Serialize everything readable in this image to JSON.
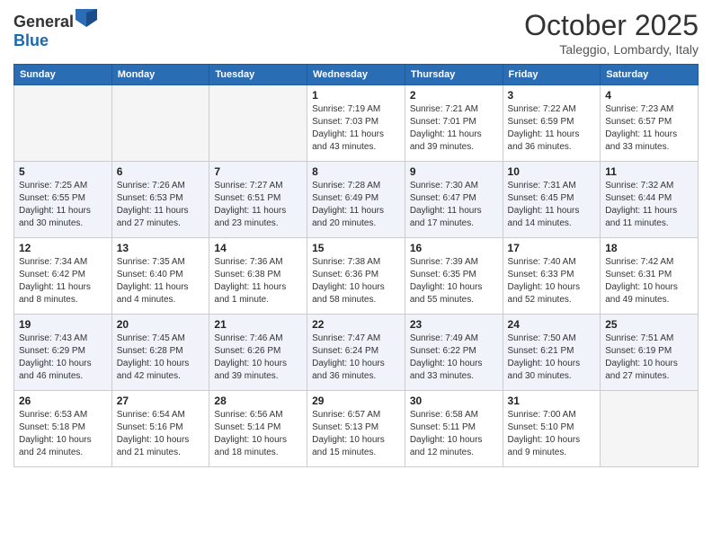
{
  "logo": {
    "text_general": "General",
    "text_blue": "Blue"
  },
  "header": {
    "month": "October 2025",
    "location": "Taleggio, Lombardy, Italy"
  },
  "days_of_week": [
    "Sunday",
    "Monday",
    "Tuesday",
    "Wednesday",
    "Thursday",
    "Friday",
    "Saturday"
  ],
  "weeks": [
    [
      {
        "day": "",
        "empty": true
      },
      {
        "day": "",
        "empty": true
      },
      {
        "day": "",
        "empty": true
      },
      {
        "day": "1",
        "sunrise": "7:19 AM",
        "sunset": "7:03 PM",
        "daylight": "11 hours and 43 minutes."
      },
      {
        "day": "2",
        "sunrise": "7:21 AM",
        "sunset": "7:01 PM",
        "daylight": "11 hours and 39 minutes."
      },
      {
        "day": "3",
        "sunrise": "7:22 AM",
        "sunset": "6:59 PM",
        "daylight": "11 hours and 36 minutes."
      },
      {
        "day": "4",
        "sunrise": "7:23 AM",
        "sunset": "6:57 PM",
        "daylight": "11 hours and 33 minutes."
      }
    ],
    [
      {
        "day": "5",
        "sunrise": "7:25 AM",
        "sunset": "6:55 PM",
        "daylight": "11 hours and 30 minutes."
      },
      {
        "day": "6",
        "sunrise": "7:26 AM",
        "sunset": "6:53 PM",
        "daylight": "11 hours and 27 minutes."
      },
      {
        "day": "7",
        "sunrise": "7:27 AM",
        "sunset": "6:51 PM",
        "daylight": "11 hours and 23 minutes."
      },
      {
        "day": "8",
        "sunrise": "7:28 AM",
        "sunset": "6:49 PM",
        "daylight": "11 hours and 20 minutes."
      },
      {
        "day": "9",
        "sunrise": "7:30 AM",
        "sunset": "6:47 PM",
        "daylight": "11 hours and 17 minutes."
      },
      {
        "day": "10",
        "sunrise": "7:31 AM",
        "sunset": "6:45 PM",
        "daylight": "11 hours and 14 minutes."
      },
      {
        "day": "11",
        "sunrise": "7:32 AM",
        "sunset": "6:44 PM",
        "daylight": "11 hours and 11 minutes."
      }
    ],
    [
      {
        "day": "12",
        "sunrise": "7:34 AM",
        "sunset": "6:42 PM",
        "daylight": "11 hours and 8 minutes."
      },
      {
        "day": "13",
        "sunrise": "7:35 AM",
        "sunset": "6:40 PM",
        "daylight": "11 hours and 4 minutes."
      },
      {
        "day": "14",
        "sunrise": "7:36 AM",
        "sunset": "6:38 PM",
        "daylight": "11 hours and 1 minute."
      },
      {
        "day": "15",
        "sunrise": "7:38 AM",
        "sunset": "6:36 PM",
        "daylight": "10 hours and 58 minutes."
      },
      {
        "day": "16",
        "sunrise": "7:39 AM",
        "sunset": "6:35 PM",
        "daylight": "10 hours and 55 minutes."
      },
      {
        "day": "17",
        "sunrise": "7:40 AM",
        "sunset": "6:33 PM",
        "daylight": "10 hours and 52 minutes."
      },
      {
        "day": "18",
        "sunrise": "7:42 AM",
        "sunset": "6:31 PM",
        "daylight": "10 hours and 49 minutes."
      }
    ],
    [
      {
        "day": "19",
        "sunrise": "7:43 AM",
        "sunset": "6:29 PM",
        "daylight": "10 hours and 46 minutes."
      },
      {
        "day": "20",
        "sunrise": "7:45 AM",
        "sunset": "6:28 PM",
        "daylight": "10 hours and 42 minutes."
      },
      {
        "day": "21",
        "sunrise": "7:46 AM",
        "sunset": "6:26 PM",
        "daylight": "10 hours and 39 minutes."
      },
      {
        "day": "22",
        "sunrise": "7:47 AM",
        "sunset": "6:24 PM",
        "daylight": "10 hours and 36 minutes."
      },
      {
        "day": "23",
        "sunrise": "7:49 AM",
        "sunset": "6:22 PM",
        "daylight": "10 hours and 33 minutes."
      },
      {
        "day": "24",
        "sunrise": "7:50 AM",
        "sunset": "6:21 PM",
        "daylight": "10 hours and 30 minutes."
      },
      {
        "day": "25",
        "sunrise": "7:51 AM",
        "sunset": "6:19 PM",
        "daylight": "10 hours and 27 minutes."
      }
    ],
    [
      {
        "day": "26",
        "sunrise": "6:53 AM",
        "sunset": "5:18 PM",
        "daylight": "10 hours and 24 minutes."
      },
      {
        "day": "27",
        "sunrise": "6:54 AM",
        "sunset": "5:16 PM",
        "daylight": "10 hours and 21 minutes."
      },
      {
        "day": "28",
        "sunrise": "6:56 AM",
        "sunset": "5:14 PM",
        "daylight": "10 hours and 18 minutes."
      },
      {
        "day": "29",
        "sunrise": "6:57 AM",
        "sunset": "5:13 PM",
        "daylight": "10 hours and 15 minutes."
      },
      {
        "day": "30",
        "sunrise": "6:58 AM",
        "sunset": "5:11 PM",
        "daylight": "10 hours and 12 minutes."
      },
      {
        "day": "31",
        "sunrise": "7:00 AM",
        "sunset": "5:10 PM",
        "daylight": "10 hours and 9 minutes."
      },
      {
        "day": "",
        "empty": true
      }
    ]
  ]
}
